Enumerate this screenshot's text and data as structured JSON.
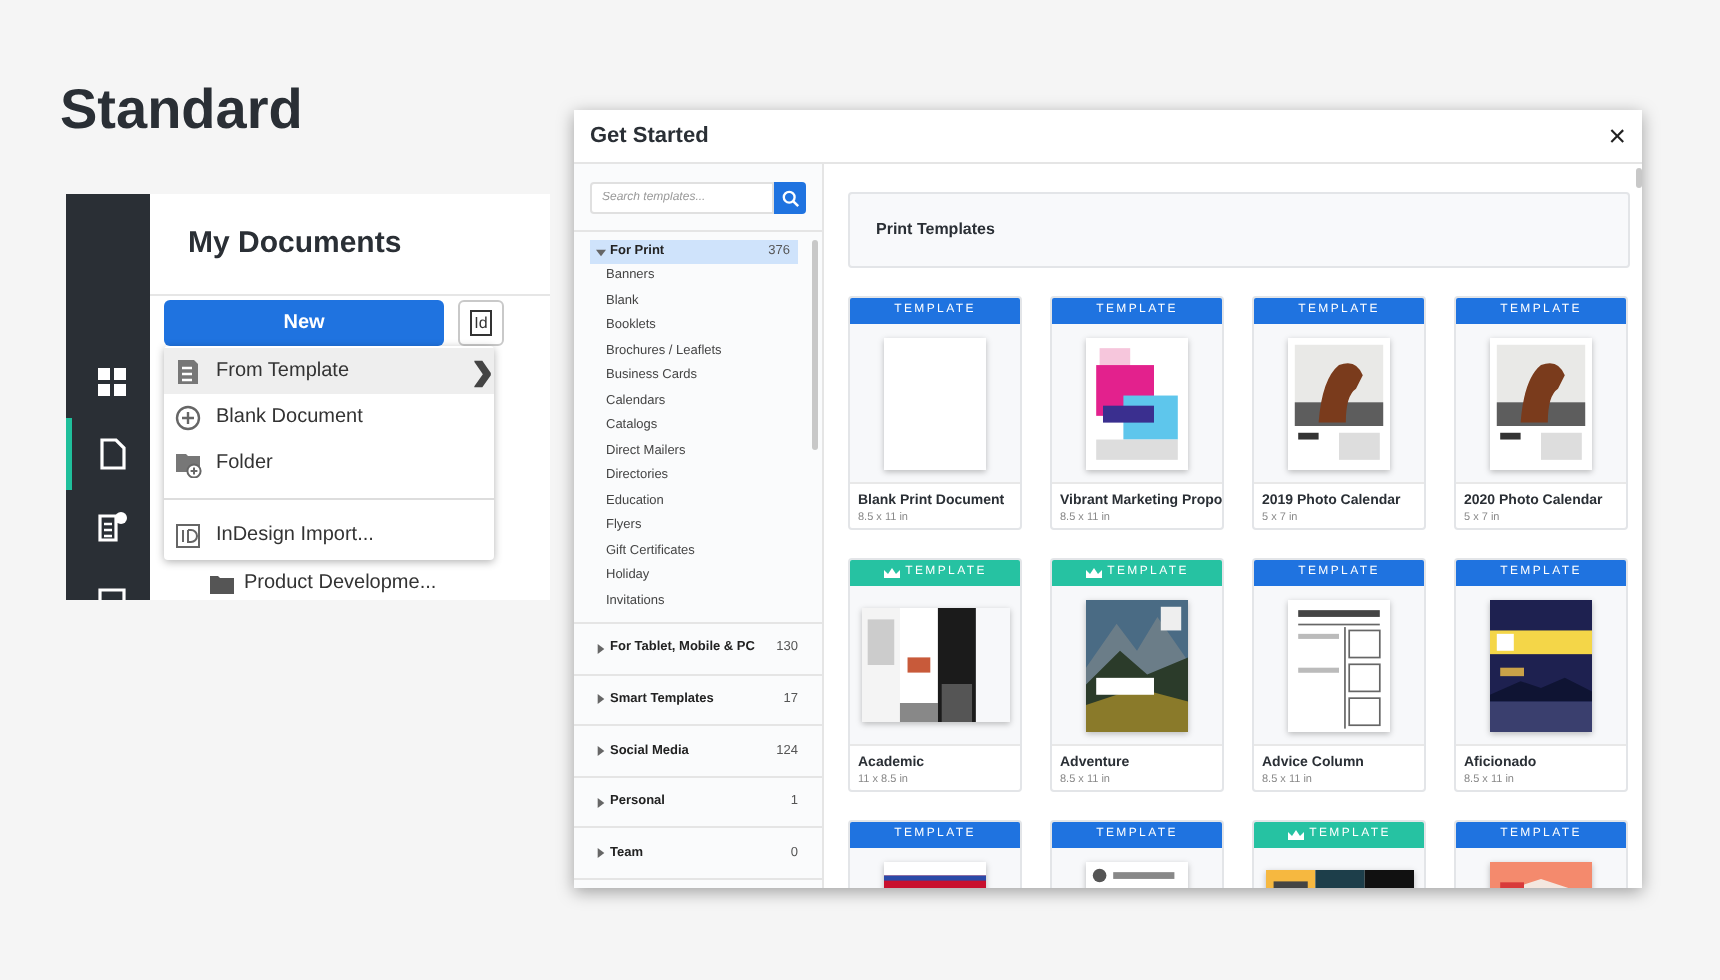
{
  "heading": "Standard",
  "app": {
    "title": "My Documents",
    "new_button": "New",
    "id_button": "Id",
    "nav_items": [
      {
        "kind": "grid",
        "selected": false
      },
      {
        "kind": "document",
        "selected": true
      },
      {
        "kind": "template",
        "selected": false
      },
      {
        "kind": "more",
        "selected": false
      }
    ],
    "menu": [
      {
        "kind": "template",
        "label": "From Template",
        "highlighted": true
      },
      {
        "kind": "blank",
        "label": "Blank Document",
        "highlighted": false
      },
      {
        "kind": "folder",
        "label": "Folder",
        "highlighted": false
      },
      {
        "kind": "import",
        "label": "InDesign Import...",
        "highlighted": false
      }
    ],
    "submenu_arrow": "›",
    "rows": [
      {
        "label": "Product Developme..."
      }
    ]
  },
  "dialog": {
    "title": "Get Started",
    "close": "×",
    "search": {
      "placeholder": "Search templates..."
    },
    "categories": [
      {
        "label": "For Print",
        "count": "376",
        "expanded": true,
        "selected": true,
        "children": [
          "Banners",
          "Blank",
          "Booklets",
          "Brochures / Leaflets",
          "Business Cards",
          "Calendars",
          "Catalogs",
          "Direct Mailers",
          "Directories",
          "Education",
          "Flyers",
          "Gift Certificates",
          "Holiday",
          "Invitations"
        ]
      },
      {
        "label": "For Tablet, Mobile & PC",
        "count": "130",
        "expanded": false,
        "selected": false
      },
      {
        "label": "Smart Templates",
        "count": "17",
        "expanded": false,
        "selected": false
      },
      {
        "label": "Social Media",
        "count": "124",
        "expanded": false,
        "selected": false
      },
      {
        "label": "Personal",
        "count": "1",
        "expanded": false,
        "selected": false
      },
      {
        "label": "Team",
        "count": "0",
        "expanded": false,
        "selected": false
      }
    ],
    "section_title": "Print Templates",
    "cards": [
      {
        "badge": "TEMPLATE",
        "premium": false,
        "kind": "blank",
        "title": "Blank Print Document",
        "size": "8.5 x 11 in"
      },
      {
        "badge": "TEMPLATE",
        "premium": false,
        "kind": "picture",
        "title": "Vibrant Marketing Propo",
        "size": "8.5 x 11 in"
      },
      {
        "badge": "TEMPLATE",
        "premium": false,
        "kind": "picture",
        "title": "2019 Photo Calendar",
        "size": "5 x 7 in"
      },
      {
        "badge": "TEMPLATE",
        "premium": false,
        "kind": "picture",
        "title": "2020 Photo Calendar",
        "size": "5 x 7 in"
      },
      {
        "badge": "TEMPLATE",
        "premium": true,
        "kind": "picture",
        "title": "Academic",
        "size": "11 x 8.5 in"
      },
      {
        "badge": "TEMPLATE",
        "premium": true,
        "kind": "picture",
        "title": "Adventure",
        "size": "8.5 x 11 in"
      },
      {
        "badge": "TEMPLATE",
        "premium": false,
        "kind": "picture",
        "title": "Advice Column",
        "size": "8.5 x 11 in"
      },
      {
        "badge": "TEMPLATE",
        "premium": false,
        "kind": "picture",
        "title": "Aficionado",
        "size": "8.5 x 11 in"
      },
      {
        "badge": "TEMPLATE",
        "premium": false,
        "kind": "picture"
      },
      {
        "badge": "TEMPLATE",
        "premium": false,
        "kind": "picture"
      },
      {
        "badge": "TEMPLATE",
        "premium": true,
        "kind": "picture"
      },
      {
        "badge": "TEMPLATE",
        "premium": false,
        "kind": "picture"
      }
    ]
  }
}
